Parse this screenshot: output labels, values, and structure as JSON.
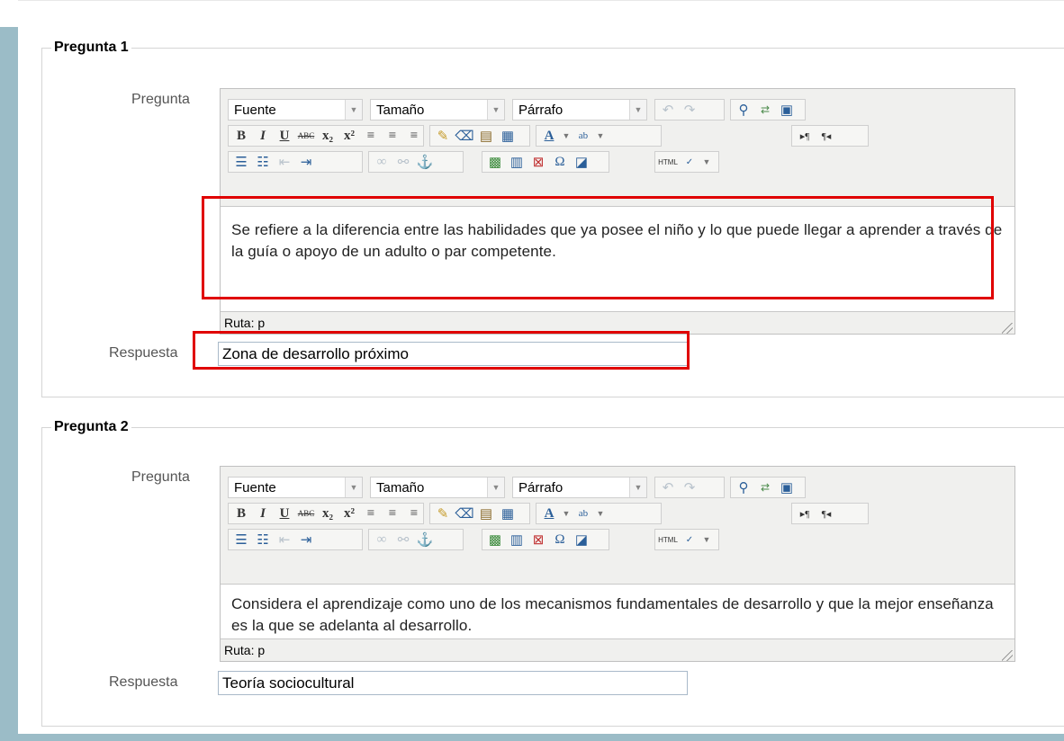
{
  "editor_toolbar": {
    "font_select": "Fuente",
    "size_select": "Tamaño",
    "format_select": "Párrafo",
    "path_label": "Ruta: p"
  },
  "questions": [
    {
      "legend": "Pregunta 1",
      "question_label": "Pregunta",
      "question_text": "Se refiere a la diferencia entre las habilidades que ya posee el niño y lo que puede llegar a aprender a través de la guía o apoyo de un adulto o par competente.",
      "answer_label": "Respuesta",
      "answer_value": "Zona de desarrollo próximo"
    },
    {
      "legend": "Pregunta 2",
      "question_label": "Pregunta",
      "question_text": "Considera el aprendizaje como uno de los mecanismos fundamentales de desarrollo y que la mejor enseñanza es la que se adelanta al desarrollo.",
      "answer_label": "Respuesta",
      "answer_value": "Teoría sociocultural"
    }
  ],
  "colors": {
    "highlight": "#e00000",
    "rail": "#9bbcc7"
  }
}
